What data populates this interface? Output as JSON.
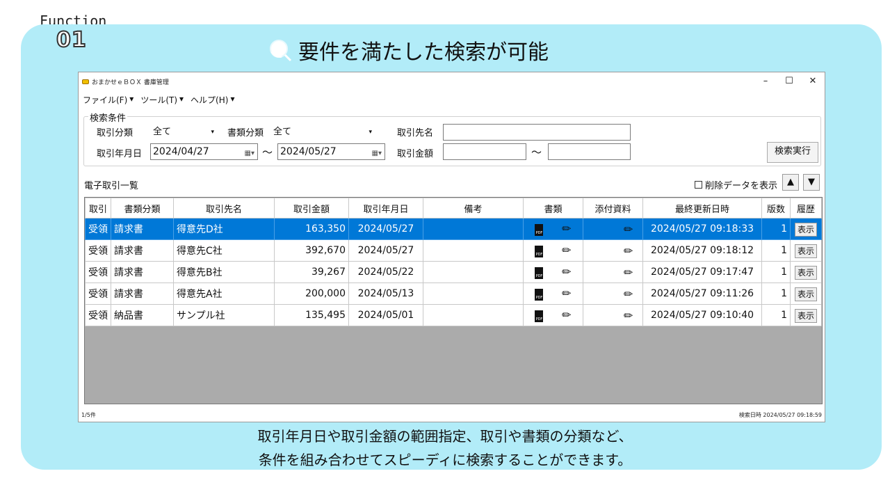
{
  "function_label": "Function",
  "function_number": "01",
  "headline": "要件を満たした検索が可能",
  "window": {
    "title": "おまかせｅＢＯＸ 書庫管理",
    "controls": [
      "–",
      "☐",
      "✕"
    ]
  },
  "menu": [
    "ファイル(F)",
    "ツール(T)",
    "ヘルプ(H)"
  ],
  "search": {
    "group_label": "検索条件",
    "trade_type_label": "取引分類",
    "trade_type_value": "全て",
    "doc_type_label": "書類分類",
    "doc_type_value": "全て",
    "partner_label": "取引先名",
    "partner_value": "",
    "date_label": "取引年月日",
    "date_from": "2024/04/27",
    "date_to": "2024/05/27",
    "amount_label": "取引金額",
    "amount_from": "",
    "amount_to": "",
    "tilde": "～",
    "execute_label": "検索実行"
  },
  "list": {
    "title": "電子取引一覧",
    "show_deleted_label": "削除データを表示",
    "columns": [
      "取引",
      "書類分類",
      "取引先名",
      "取引金額",
      "取引年月日",
      "備考",
      "書類",
      "添付資料",
      "最終更新日時",
      "版数",
      "履歴"
    ],
    "show_label": "表示",
    "rows": [
      {
        "trade": "受領",
        "doc_type": "請求書",
        "partner": "得意先D社",
        "amount": "163,350",
        "date": "2024/05/27",
        "note": "",
        "updated": "2024/05/27 09:18:33",
        "version": "1",
        "selected": true
      },
      {
        "trade": "受領",
        "doc_type": "請求書",
        "partner": "得意先C社",
        "amount": "392,670",
        "date": "2024/05/27",
        "note": "",
        "updated": "2024/05/27 09:18:12",
        "version": "1",
        "selected": false
      },
      {
        "trade": "受領",
        "doc_type": "請求書",
        "partner": "得意先B社",
        "amount": "39,267",
        "date": "2024/05/22",
        "note": "",
        "updated": "2024/05/27 09:17:47",
        "version": "1",
        "selected": false
      },
      {
        "trade": "受領",
        "doc_type": "請求書",
        "partner": "得意先A社",
        "amount": "200,000",
        "date": "2024/05/13",
        "note": "",
        "updated": "2024/05/27 09:11:26",
        "version": "1",
        "selected": false
      },
      {
        "trade": "受領",
        "doc_type": "納品書",
        "partner": "サンプル社",
        "amount": "135,495",
        "date": "2024/05/01",
        "note": "",
        "updated": "2024/05/27 09:10:40",
        "version": "1",
        "selected": false
      }
    ]
  },
  "status": {
    "count": "1/5件",
    "search_time": "検索日時 2024/05/27 09:18:59"
  },
  "caption": {
    "line1": "取引年月日や取引金額の範囲指定、取引や書類の分類など、",
    "line2": "条件を組み合わせてスピーディに検索することができます。"
  },
  "colors": {
    "panel": "#b2ecf8",
    "selection": "#0078d7",
    "grid_bg": "#ababab"
  }
}
